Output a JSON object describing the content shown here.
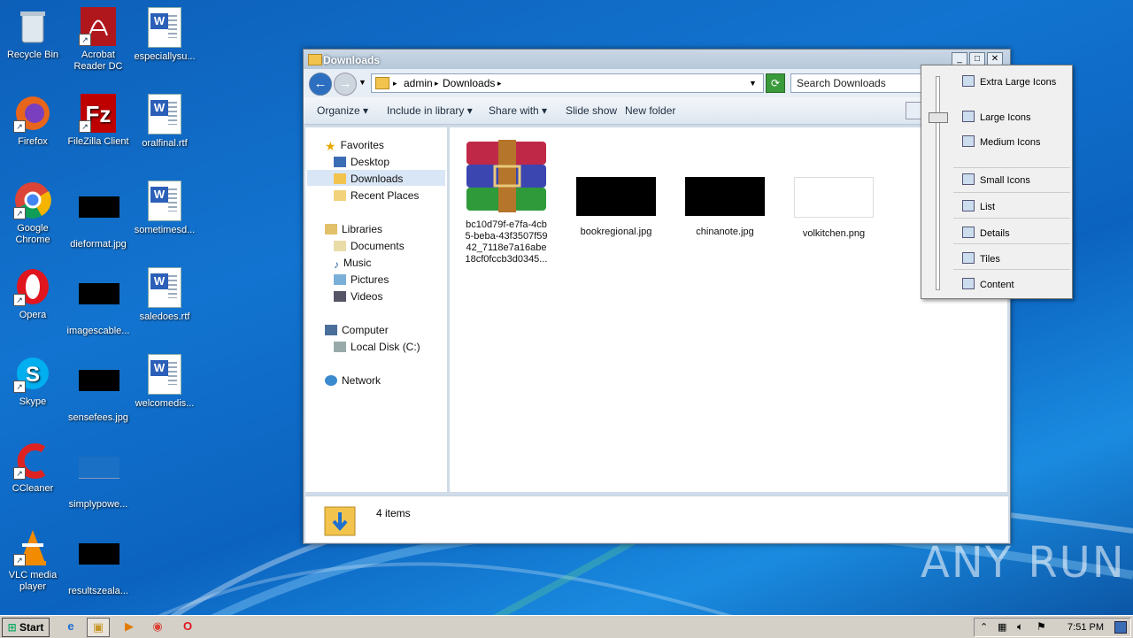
{
  "desktop": {
    "icons": [
      {
        "label": "Recycle Bin",
        "icon": "recycle-bin-icon"
      },
      {
        "label": "Acrobat Reader DC",
        "icon": "acrobat-icon"
      },
      {
        "label": "especiallysu...",
        "icon": "word-doc-icon"
      },
      {
        "label": "Firefox",
        "icon": "firefox-icon"
      },
      {
        "label": "FileZilla Client",
        "icon": "filezilla-icon"
      },
      {
        "label": "oralfinal.rtf",
        "icon": "word-doc-icon"
      },
      {
        "label": "Google Chrome",
        "icon": "chrome-icon"
      },
      {
        "label": "dieformat.jpg",
        "icon": "image-thumb-icon"
      },
      {
        "label": "sometimesd...",
        "icon": "word-doc-icon"
      },
      {
        "label": "Opera",
        "icon": "opera-icon"
      },
      {
        "label": "imagescable...",
        "icon": "image-thumb-icon"
      },
      {
        "label": "saledoes.rtf",
        "icon": "word-doc-icon"
      },
      {
        "label": "Skype",
        "icon": "skype-icon"
      },
      {
        "label": "sensefees.jpg",
        "icon": "image-thumb-icon"
      },
      {
        "label": "welcomedis...",
        "icon": "word-doc-icon"
      },
      {
        "label": "CCleaner",
        "icon": "ccleaner-icon"
      },
      {
        "label": "simplypowe...",
        "icon": "image-thumb-icon"
      },
      {
        "label": "VLC media player",
        "icon": "vlc-icon"
      },
      {
        "label": "resultszeala...",
        "icon": "image-thumb-icon"
      }
    ]
  },
  "window": {
    "title": "Downloads",
    "breadcrumb": [
      "admin",
      "Downloads"
    ],
    "search_placeholder": "Search Downloads",
    "toolbar": {
      "organize": "Organize",
      "include": "Include in library",
      "share": "Share with",
      "slideshow": "Slide show",
      "newfolder": "New folder"
    },
    "nav": {
      "favorites": "Favorites",
      "desktop": "Desktop",
      "downloads": "Downloads",
      "recent": "Recent Places",
      "libraries": "Libraries",
      "documents": "Documents",
      "music": "Music",
      "pictures": "Pictures",
      "videos": "Videos",
      "computer": "Computer",
      "localdisk": "Local Disk (C:)",
      "network": "Network"
    },
    "files": [
      {
        "name": "bc10d79f-e7fa-4cb5-beba-43f3507f5942_7118e7a16abe18cf0fccb3d0345...",
        "type": "winrar-archive-icon"
      },
      {
        "name": "bookregional.jpg",
        "type": "image-thumb"
      },
      {
        "name": "chinanote.jpg",
        "type": "image-thumb"
      },
      {
        "name": "volkitchen.png",
        "type": "image-thumb"
      }
    ],
    "status": "4 items"
  },
  "view_menu": {
    "items": [
      "Extra Large Icons",
      "Large Icons",
      "Medium Icons",
      "Small Icons",
      "List",
      "Details",
      "Tiles",
      "Content"
    ]
  },
  "watermark": "ANY RUN",
  "taskbar": {
    "start": "Start",
    "clock": "7:51 PM"
  }
}
